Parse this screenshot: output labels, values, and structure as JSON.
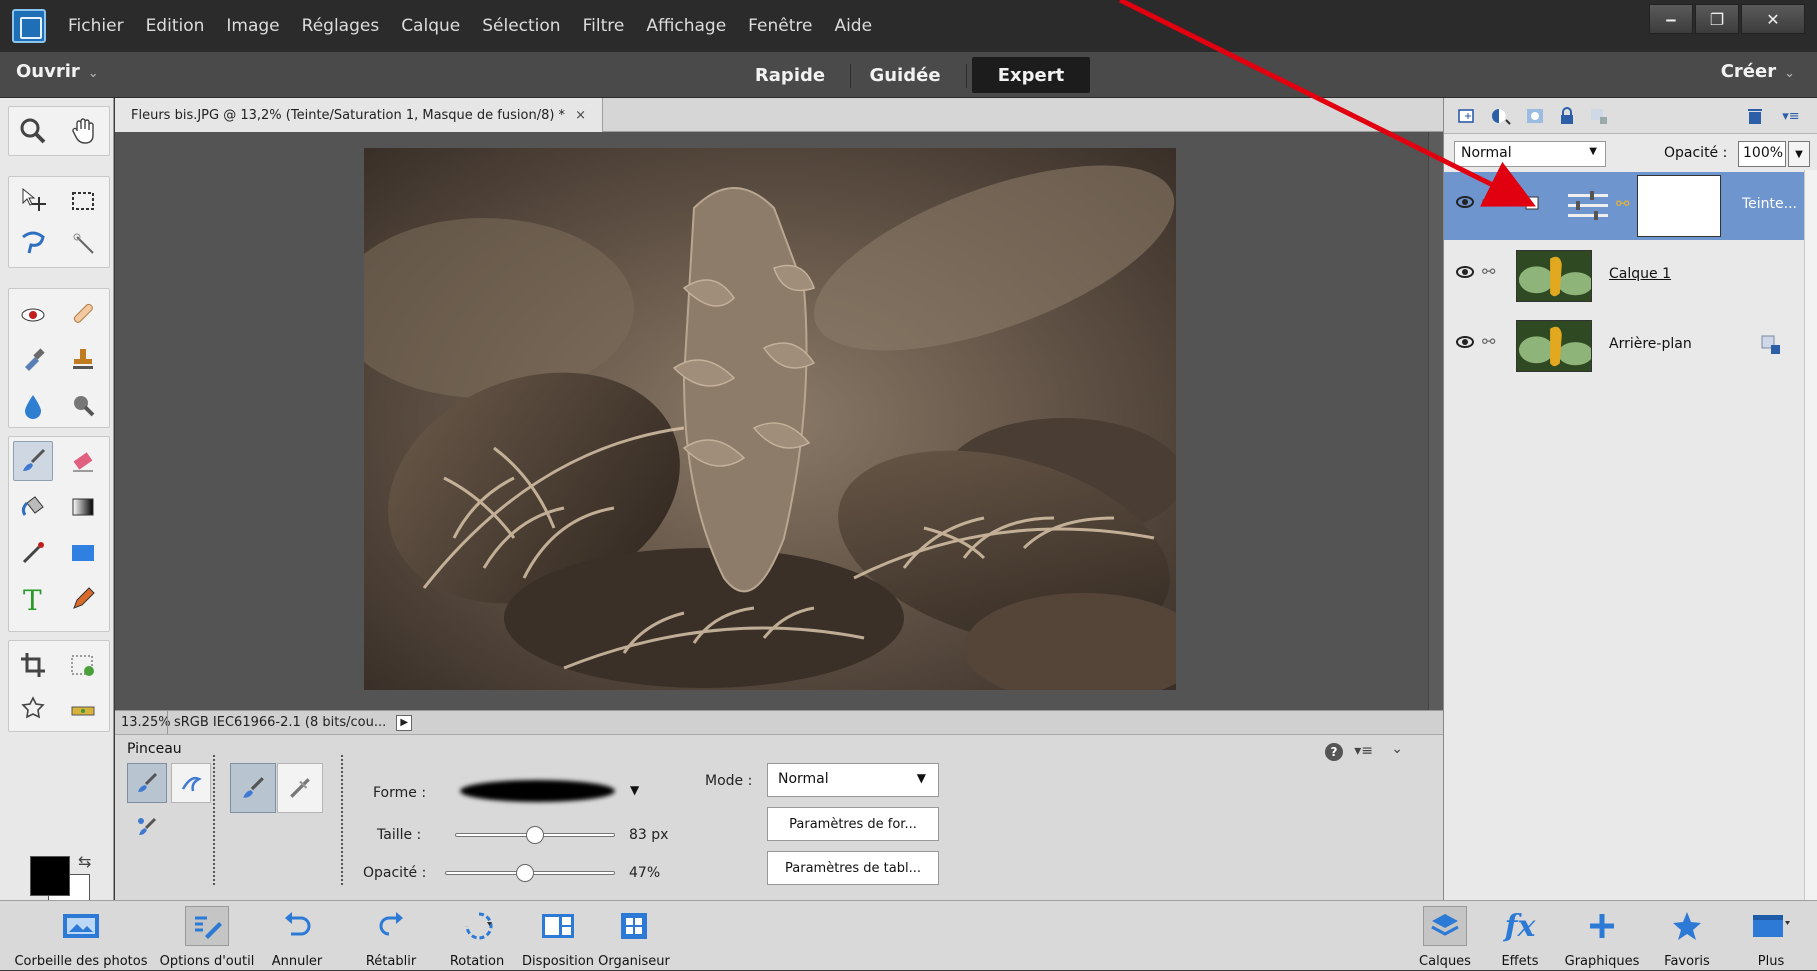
{
  "menubar": {
    "items": [
      "Fichier",
      "Edition",
      "Image",
      "Réglages",
      "Calque",
      "Sélection",
      "Filtre",
      "Affichage",
      "Fenêtre",
      "Aide"
    ]
  },
  "modebar": {
    "open_label": "Ouvrir",
    "tabs": [
      "Rapide",
      "Guidée",
      "Expert"
    ],
    "active_tab": "Expert",
    "create_label": "Créer"
  },
  "document": {
    "tab_title": "Fleurs bis.JPG @ 13,2% (Teinte/Saturation 1, Masque de fusion/8) *",
    "close_glyph": "×"
  },
  "status": {
    "zoom": "13.25%",
    "profile": "sRGB IEC61966-2.1 (8 bits/cou...",
    "arrow_glyph": "▶"
  },
  "tool_options": {
    "title": "Pinceau",
    "shape_label": "Forme :",
    "size_label": "Taille :",
    "size_value": "83 px",
    "size_fraction": 0.5,
    "opacity_label": "Opacité :",
    "opacity_value": "47%",
    "opacity_fraction": 0.47,
    "mode_label": "Mode :",
    "mode_value": "Normal",
    "brush_settings_btn": "Paramètres de for...",
    "tablet_settings_btn": "Paramètres de tabl...",
    "help_glyph": "?",
    "menu_glyph": "▾≡",
    "collapse_glyph": "⌄"
  },
  "layers_panel": {
    "blend_mode": "Normal",
    "opacity_label": "Opacité :",
    "opacity_value": "100%",
    "layers": [
      {
        "name": "Teinte...",
        "selected": true,
        "type": "adjustment"
      },
      {
        "name": "Calque 1",
        "selected": false,
        "type": "image"
      },
      {
        "name": "Arrière-plan",
        "selected": false,
        "type": "image",
        "locked": true
      }
    ]
  },
  "bottombar": {
    "left": [
      {
        "label": "Corbeille des photos",
        "icon": "photo-bin-icon"
      },
      {
        "label": "Options d'outil",
        "icon": "tool-options-icon",
        "active": true
      },
      {
        "label": "Annuler",
        "icon": "undo-icon"
      },
      {
        "label": "Rétablir",
        "icon": "redo-icon"
      },
      {
        "label": "Rotation",
        "icon": "rotate-icon"
      },
      {
        "label": "Disposition",
        "icon": "layout-icon"
      },
      {
        "label": "Organiseur",
        "icon": "organizer-icon"
      }
    ],
    "right": [
      {
        "label": "Calques",
        "icon": "layers-icon"
      },
      {
        "label": "Effets",
        "icon": "fx-icon"
      },
      {
        "label": "Graphiques",
        "icon": "plus-icon"
      },
      {
        "label": "Favoris",
        "icon": "star-icon"
      },
      {
        "label": "Plus",
        "icon": "more-icon"
      }
    ]
  },
  "colors": {
    "menubar_bg": "#2b2b2b",
    "selected_layer": "#6f95cf",
    "annotation_arrow": "#e0000f",
    "foreground": "#000000",
    "background": "#ffffff"
  }
}
